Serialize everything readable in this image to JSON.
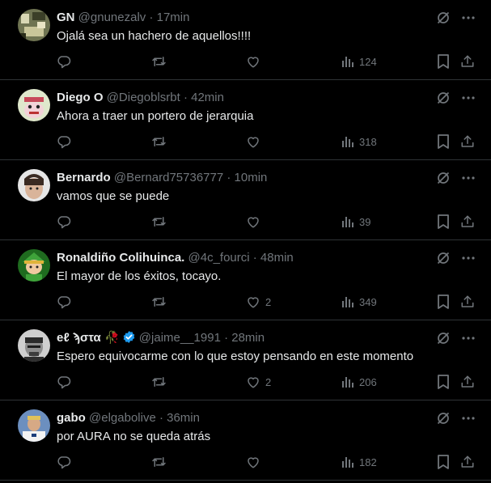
{
  "tweets": [
    {
      "display_name": "GN",
      "meta": "@gnunezalv · 17min",
      "text": "Ojalá sea un hachero de aquellos!!!!",
      "likes": "",
      "views": "124",
      "avatar_color": "#8a8f6a"
    },
    {
      "display_name": "Diego O",
      "meta": "@Diegoblsrbt · 42min",
      "text": "Ahora a traer un portero de jerarquia",
      "likes": "",
      "views": "318",
      "avatar_color": "#c8d8b0"
    },
    {
      "display_name": "Bernardo",
      "meta": "@Bernard75736777 · 10min",
      "text": "vamos que se puede",
      "likes": "",
      "views": "39",
      "avatar_color": "#dddddd"
    },
    {
      "display_name": "Ronaldiño Colihuinca.",
      "meta": "@4c_fourci · 48min",
      "text": "El mayor de los éxitos, tocayo.",
      "likes": "2",
      "views": "349",
      "avatar_color": "#2f8a2a"
    },
    {
      "display_name": "eℓ ϡστα",
      "name_emoji": "🥀",
      "verified": true,
      "meta": "@jaime__1991 · 28min",
      "text": "Espero equivocarme con lo que estoy pensando en este momento",
      "likes": "2",
      "views": "206",
      "avatar_color": "#cfcfcf"
    },
    {
      "display_name": "gabo",
      "meta": "@elgabolive · 36min",
      "text": "por AURA no se queda atrás",
      "likes": "",
      "views": "182",
      "avatar_color": "#5a7fb0"
    }
  ],
  "colors": {
    "background": "#000000",
    "text": "#e7e9ea",
    "muted": "#71767b",
    "divider": "#2f3336",
    "verified": "#1d9bf0"
  },
  "icons": [
    "grok-icon",
    "more-icon",
    "reply-icon",
    "retweet-icon",
    "like-icon",
    "views-icon",
    "bookmark-icon",
    "share-icon",
    "verified-icon"
  ]
}
